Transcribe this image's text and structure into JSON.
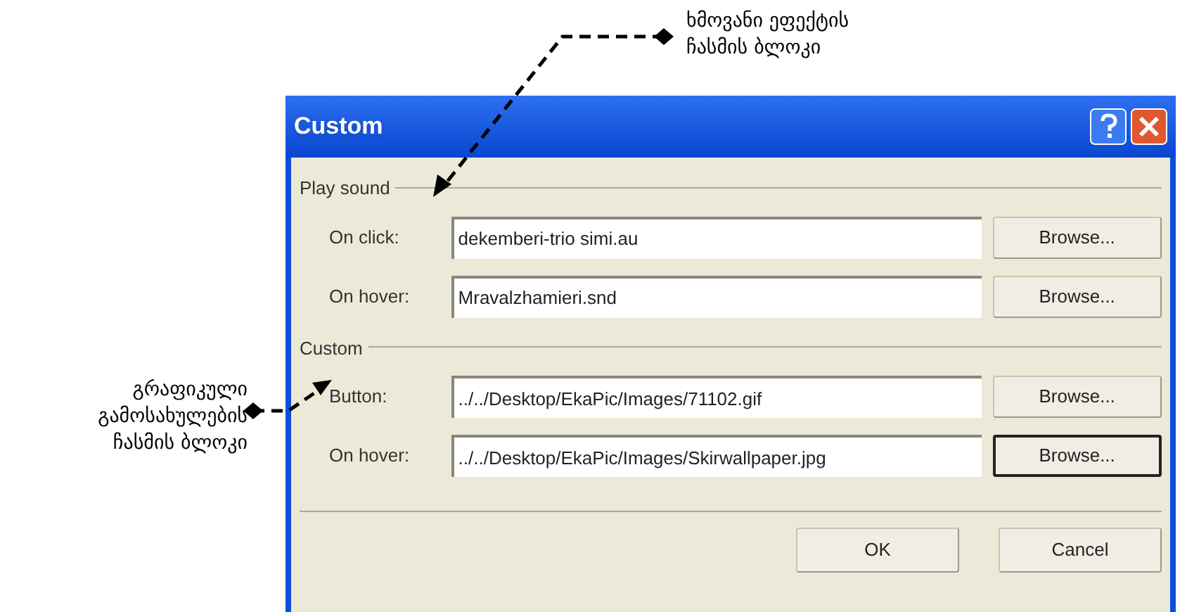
{
  "annotations": [
    {
      "kind": "top",
      "text": "ხმოვანი ეფექტის\nჩასმის ბლოკი"
    },
    {
      "kind": "left",
      "text": "გრაფიკული\nგამოსახულების\nჩასმის ბლოკი"
    }
  ],
  "window": {
    "title": "Custom"
  },
  "groups": [
    {
      "label": "Play sound",
      "rows": [
        {
          "label": "On click:",
          "value": "dekemberi-trio simi.au",
          "button": "Browse...",
          "default": false
        },
        {
          "label": "On hover:",
          "value": "Mravalzhamieri.snd",
          "button": "Browse...",
          "default": false
        }
      ]
    },
    {
      "label": "Custom",
      "rows": [
        {
          "label": "Button:",
          "value": "../../Desktop/EkaPic/Images/71102.gif",
          "button": "Browse...",
          "default": false
        },
        {
          "label": "On hover:",
          "value": "../../Desktop/EkaPic/Images/Skirwallpaper.jpg",
          "button": "Browse...",
          "default": true
        }
      ]
    }
  ],
  "buttons": [
    "OK",
    "Cancel"
  ]
}
